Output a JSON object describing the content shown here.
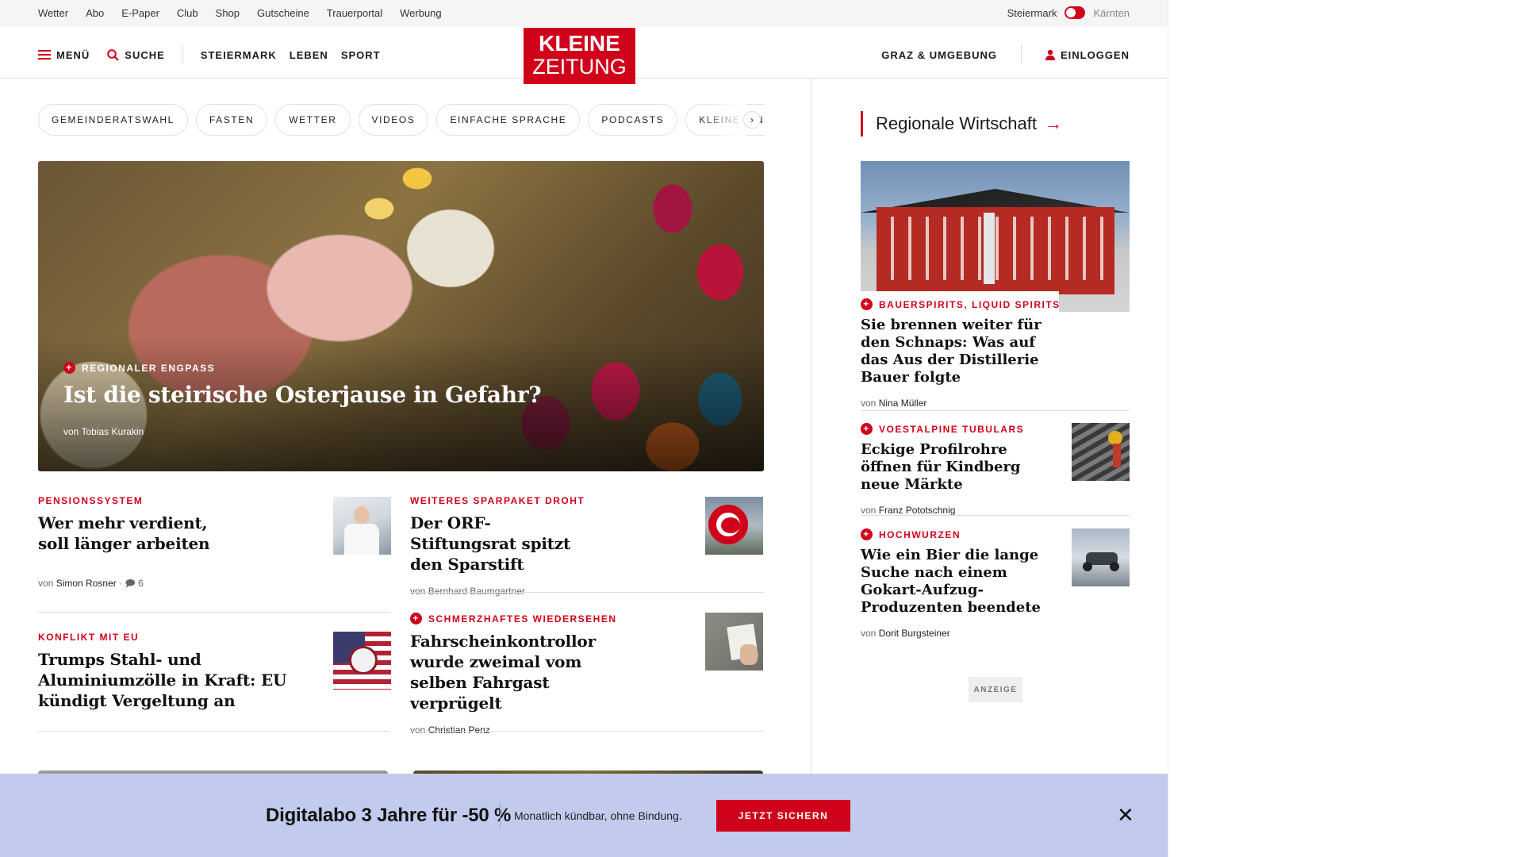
{
  "utility": {
    "links": [
      "Wetter",
      "Abo",
      "E-Paper",
      "Club",
      "Shop",
      "Gutscheine",
      "Trauerportal",
      "Werbung"
    ],
    "region_active": "Steiermark",
    "region_other": "Kärnten"
  },
  "header": {
    "menu_label": "MENÜ",
    "search_label": "SUCHE",
    "nav": [
      "STEIERMARK",
      "LEBEN",
      "SPORT"
    ],
    "logo_line1": "KLEINE",
    "logo_line2": "ZEITUNG",
    "region_link": "GRAZ & UMGEBUNG",
    "login_label": "EINLOGGEN"
  },
  "chips": [
    "GEMEINDERATSWAHL",
    "FASTEN",
    "WETTER",
    "VIDEOS",
    "EINFACHE SPRACHE",
    "PODCASTS",
    "KLEINE KINDE"
  ],
  "hero": {
    "kicker": "REGIONALER ENGPASS",
    "title": "Ist die steirische Osterjause in Gefahr?",
    "author": "von Tobias Kurakin"
  },
  "teasers": [
    {
      "kicker": "PENSIONSSYSTEM",
      "title": "Wer mehr verdient, soll länger arbeiten",
      "author_prefix": "von",
      "author": "Simon Rosner",
      "comments": "6",
      "plus": false
    },
    {
      "kicker": "WEITERES SPARPAKET DROHT",
      "title": "Der ORF-Stiftungsrat spitzt den Sparstift",
      "author_prefix": "von",
      "author": "Bernhard Baumgartner",
      "plus": false
    },
    {
      "kicker": "KONFLIKT MIT EU",
      "title": "Trumps Stahl- und Aluminiumzölle in Kraft: EU kündigt Vergeltung an",
      "plus": false
    },
    {
      "kicker": "SCHMERZHAFTES WIEDERSEHEN",
      "title": "Fahrscheinkontrollor wurde zweimal vom selben Fahrgast verprügelt",
      "author_prefix": "von",
      "author": "Christian Penz",
      "plus": true
    }
  ],
  "sidebar": {
    "heading": "Regionale Wirtschaft",
    "items": [
      {
        "kicker": "BAUERSPIRITS, LIQUID SPIRITS",
        "title": "Sie brennen weiter für den Schnaps: Was auf das Aus der Distillerie Bauer folgte",
        "author_prefix": "von",
        "author": "Nina Müller"
      },
      {
        "kicker": "VOESTALPINE TUBULARS",
        "title": "Eckige Profilrohre öffnen für Kindberg neue Märkte",
        "author_prefix": "von",
        "author": "Franz Pototschnig"
      },
      {
        "kicker": "HOCHWURZEN",
        "title": "Wie ein Bier die lange Suche nach einem Gokart-Aufzug-Produzenten beendete",
        "author_prefix": "von",
        "author": "Dorit Burgsteiner"
      }
    ],
    "ad_label": "ANZEIGE"
  },
  "promo": {
    "title": "Digitalabo 3 Jahre für -50 %",
    "subtitle": "Monatlich kündbar, ohne Bindung.",
    "button": "JETZT SICHERN"
  },
  "colors": {
    "brand_red": "#d0021b",
    "promo_bg": "#c2caee"
  }
}
